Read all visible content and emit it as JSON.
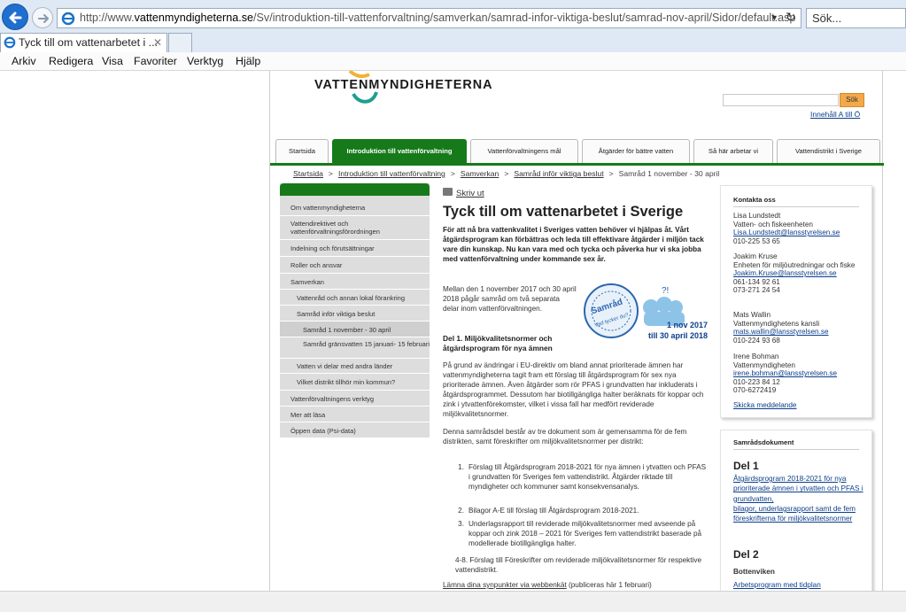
{
  "browser": {
    "url_prefix": "http://www.",
    "url_domain": "vattenmyndigheterna.se",
    "url_path": "/Sv/introduktion-till-vattenforvaltning/samverkan/samrad-infor-viktiga-beslut/samrad-nov-april/Sidor/default.asp",
    "search_placeholder": "Sök...",
    "tab_title": "Tyck till om vattenarbetet i ...",
    "tab_close": "✕",
    "menu": [
      "Arkiv",
      "Redigera",
      "Visa",
      "Favoriter",
      "Verktyg",
      "Hjälp"
    ]
  },
  "site": {
    "logo_text": "VATTENMYNDIGHETERNA",
    "search_button": "Sök",
    "a_to_o": "Innehåll A till Ö",
    "topnav": [
      "Startsida",
      "Introduktion till vattenförvaltning",
      "Vattenförvaltningens mål",
      "Åtgärder för bättre vatten",
      "Så här arbetar vi",
      "Vattendistrikt i Sverige"
    ],
    "breadcrumb": [
      "Startsida",
      "Introduktion till vattenförvaltning",
      "Samverkan",
      "Samråd inför viktiga beslut",
      "Samråd 1 november - 30 april"
    ],
    "breadcrumb_sep": ">",
    "leftnav": [
      "Om vattenmyndigheterna",
      "Vattendirektivet och vattenförvaltningsförordningen",
      "Indelning och förutsättningar",
      "Roller och ansvar",
      "Samverkan",
      "Vattenråd och annan lokal förankring",
      "Samråd inför viktiga beslut",
      "Samråd 1 november - 30 april",
      "Samråd gränsvatten 15 januari- 15 februari",
      "Vatten vi delar med andra länder",
      "Vilket distrikt tillhör min kommun?",
      "Vattenförvaltningens verktyg",
      "Mer att läsa",
      "Öppen data (Psi-data)"
    ]
  },
  "article": {
    "print": "Skriv ut",
    "title": "Tyck till om vattenarbetet i Sverige",
    "lead": "För att nå bra vattenkvalitet i Sveriges vatten behöver vi hjälpas åt. Vårt åtgärdsprogram kan förbättras och leda till effektivare åtgärder i miljön tack vare din kunskap. Nu kan vara med och tycka och påverka hur vi ska jobba med vattenförvaltning under kommande sex år.",
    "intro": "Mellan den 1 november 2017 och 30 april 2018 pågår samråd om två separata delar inom vattenförvaltningen.",
    "badge": {
      "word": "Samråd",
      "sub": "Vad tycker du?",
      "date1": "1 nov 2017",
      "date2": "till 30 april 2018"
    },
    "del1_heading": "Del 1. Miljökvalitetsnormer och åtgärdsprogram för nya ämnen",
    "para1": "På grund av ändringar i EU-direktiv om bland annat prioriterade ämnen har vattenmyndigheterna tagit fram ett förslag till åtgärdsprogram för sex nya prioriterade ämnen. Även åtgärder som rör PFAS i grundvatten har inkluderats i åtgärdsprogrammet. Dessutom har biotillgängliga halter beräknats för koppar och zink i ytvattenförekomster, vilket i vissa fall har medfört reviderade miljökvalitetsnormer.",
    "para2": "Denna samrådsdel består av tre dokument som är gemensamma för de fem distrikten, samt föreskrifter om miljökvalitetsnormer per distrikt:",
    "list": [
      {
        "num": "1.",
        "text": "Förslag till Åtgärdsprogram 2018-2021 för nya ämnen i ytvatten och PFAS i grundvatten för Sveriges fem vattendistrikt. Åtgärder riktade till myndigheter och kommuner samt konsekvensanalys."
      },
      {
        "num": "2.",
        "text": "Bilagor A-E till förslag till Åtgärdsprogram 2018-2021."
      },
      {
        "num": "3.",
        "text": "Underlagsrapport till reviderade miljökvalitetsnormer med avseende på koppar och zink 2018 – 2021 för Sveriges fem vattendistrikt baserade på modellerade biotillgängliga halter."
      }
    ],
    "item48": "4-8. Förslag till Föreskrifter om reviderade miljökvalitetsnormer för respektive vattendistrikt.",
    "lamna_link": "Lämna dina synpunkter via webbenkät",
    "lamna_rest": " (publiceras här 1 februari)"
  },
  "contacts": {
    "heading": "Kontakta oss",
    "people": [
      {
        "name": "Lisa Lundstedt",
        "org": "Vatten- och fiskeenheten",
        "email": "Lisa.Lundstedt@lansstyrelsen.se",
        "phones": [
          "010-225 53 65"
        ]
      },
      {
        "name": "Joakim Kruse",
        "org": "Enheten för miljöutredningar och fiske",
        "email": "Joakim.Kruse@lansstyrelsen.se",
        "phones": [
          "061-134 92 61",
          "073-271 24 54"
        ]
      },
      {
        "name": "Mats Wallin",
        "org": "Vattenmyndighetens kansli",
        "email": "mats.wallin@lansstyrelsen.se",
        "phones": [
          "010-224 93 68"
        ]
      },
      {
        "name": "Irene Bohman",
        "org": "Vattenmyndigheten",
        "email": "irene.bohman@lansstyrelsen.se",
        "phones": [
          "010-223 84 12",
          "070-6272419"
        ]
      }
    ],
    "send": "Skicka meddelande"
  },
  "documents": {
    "heading": "Samrådsdokument",
    "del1": "Del 1",
    "del1_link1": "Åtgärdsprogram 2018-2021 för nya prioriterade ämnen i ytvatten och PFAS i grundvatten,",
    "del1_link2": "bilagor, underlagsrapport samt de fem föreskrifterna för miljökvalitetsnormer",
    "del2": "Del 2",
    "del2_sub": "Bottenviken",
    "del2_link": "Arbetsprogram med tidplan"
  }
}
